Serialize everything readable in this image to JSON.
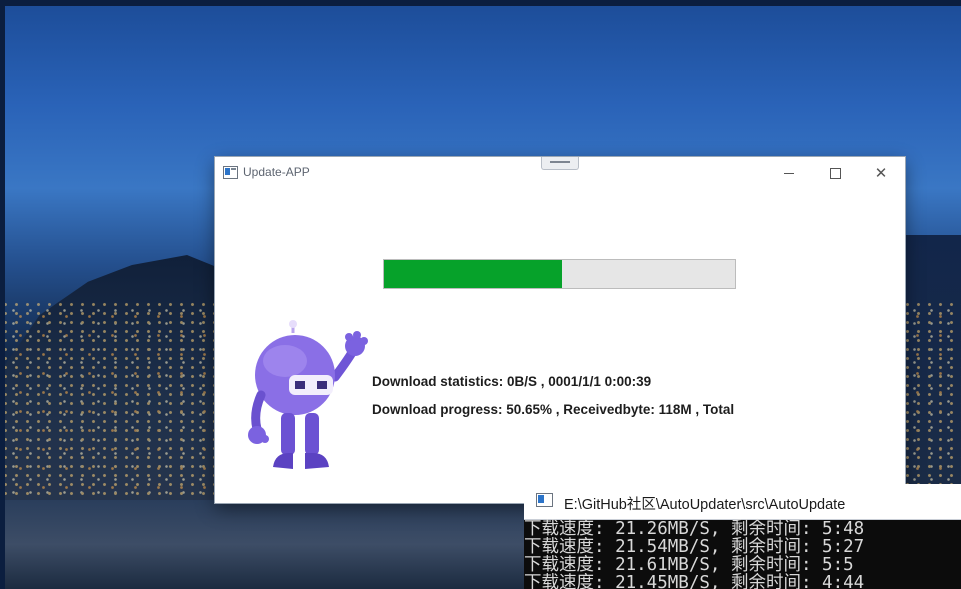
{
  "desktop": {
    "wallpaper": "night city"
  },
  "update_window": {
    "title": "Update-APP",
    "controls": {
      "minimize": "—",
      "maximize": "☐",
      "close": "✕"
    },
    "progress_fraction": 0.5065,
    "accent_color": "#06a22a",
    "download_statistics": "Download statistics: 0B/S , 0001/1/1 0:00:39",
    "download_progress": "Download progress: 50.65% ,   Receivedbyte:  118M ,  Total"
  },
  "console_window": {
    "title": "E:\\GitHub社区\\AutoUpdater\\src\\AutoUpdate",
    "lines": [
      "下载速度: 21.26MB/S, 剩余时间: 5:48",
      "下载速度: 21.54MB/S, 剩余时间: 5:27",
      "下载速度: 21.61MB/S, 剩余时间: 5:5",
      "下载速度: 21.45MB/S, 剩余时间: 4:44"
    ]
  }
}
